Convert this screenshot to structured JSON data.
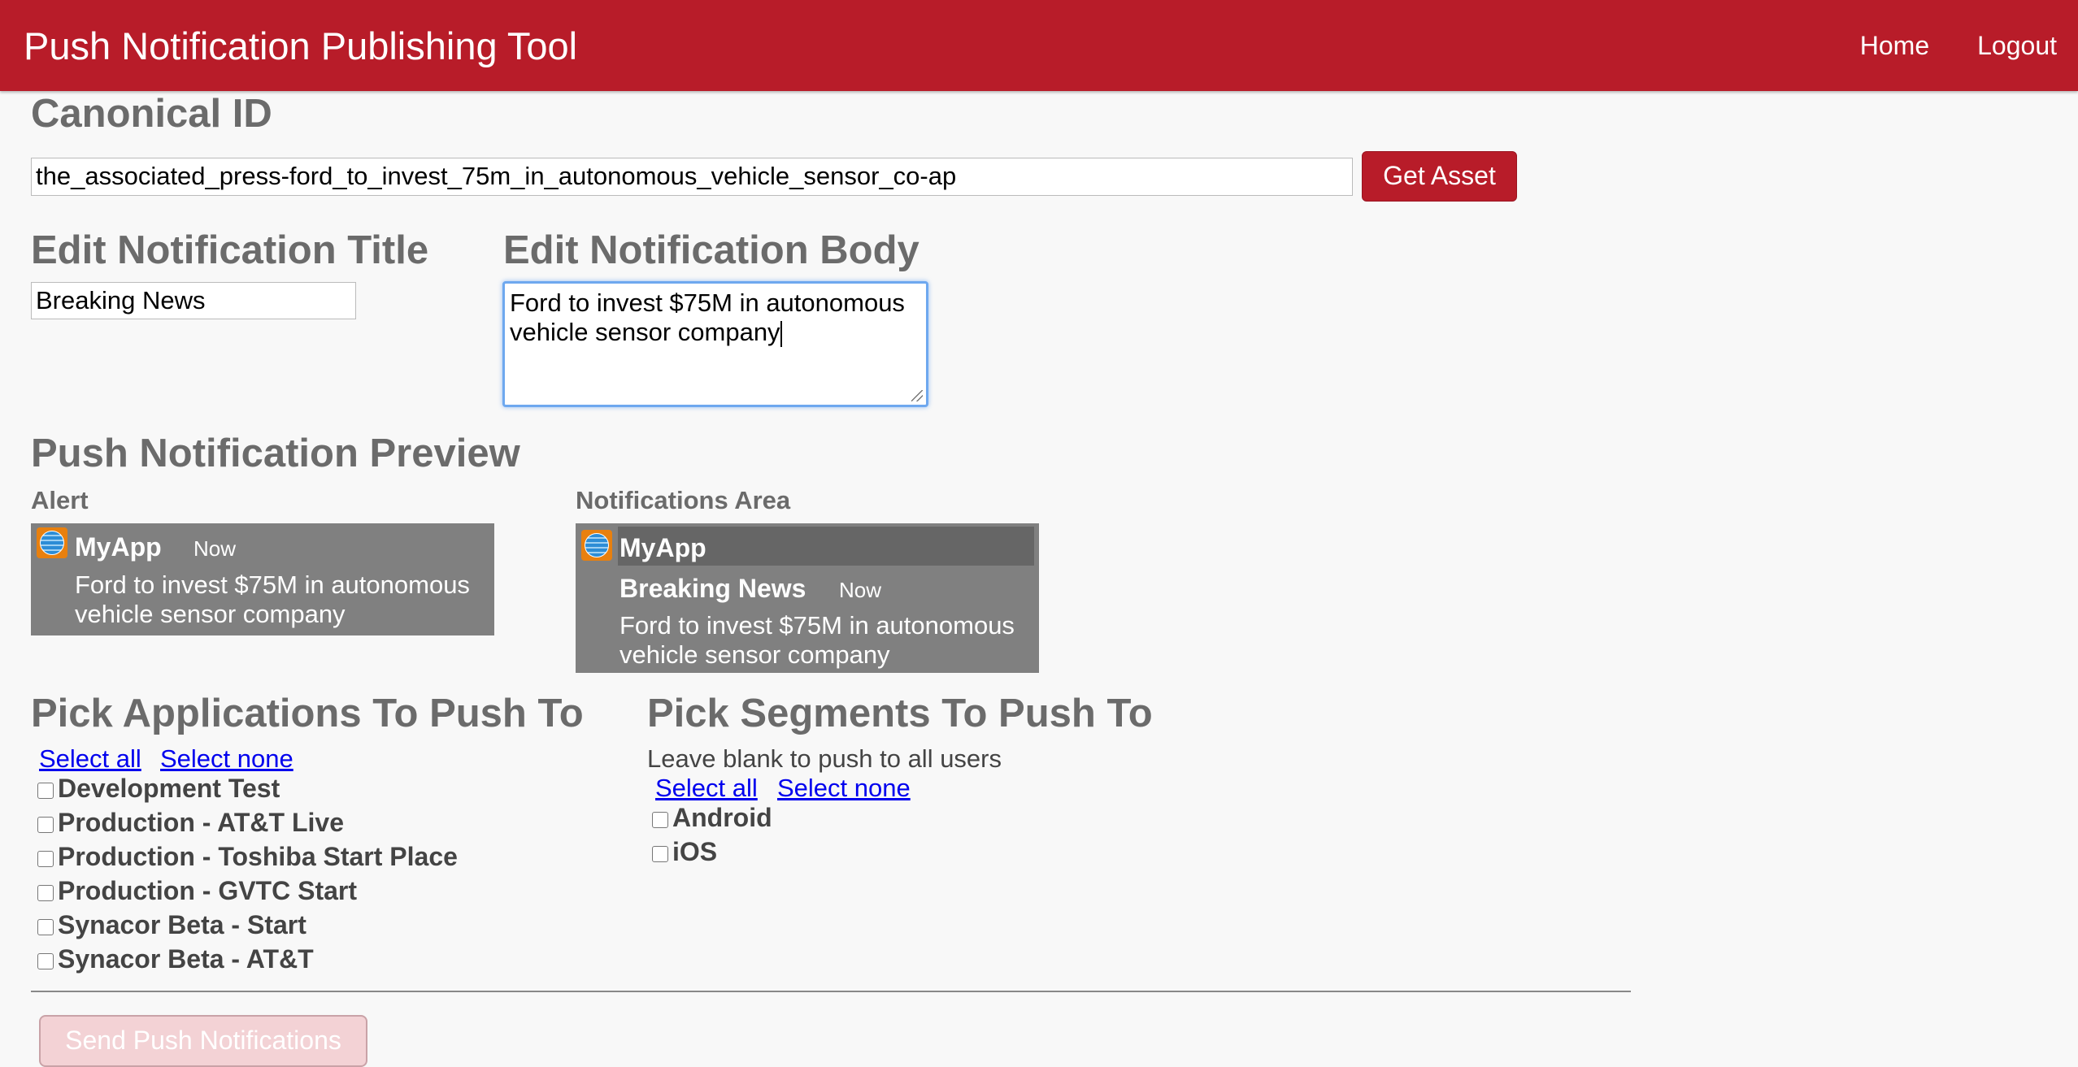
{
  "navbar": {
    "title": "Push Notification Publishing Tool",
    "links": [
      "Home",
      "Logout"
    ]
  },
  "canonical": {
    "heading": "Canonical ID",
    "value": "the_associated_press-ford_to_invest_75m_in_autonomous_vehicle_sensor_co-ap",
    "button": "Get Asset"
  },
  "edit_title": {
    "heading": "Edit Notification Title",
    "value": "Breaking News"
  },
  "edit_body": {
    "heading": "Edit Notification Body",
    "line1": "Ford to invest $75M in autonomous",
    "line2": "vehicle sensor company"
  },
  "preview": {
    "heading": "Push Notification Preview",
    "alert": {
      "label": "Alert",
      "app": "MyApp",
      "time": "Now",
      "line1": "Ford to invest $75M in autonomous",
      "line2": "vehicle sensor company"
    },
    "notifications": {
      "label": "Notifications Area",
      "app": "MyApp",
      "title": "Breaking News",
      "time": "Now",
      "line1": "Ford to invest $75M in autonomous",
      "line2": "vehicle sensor company"
    }
  },
  "applications": {
    "heading": "Pick Applications To Push To",
    "select_all": "Select all",
    "select_none": "Select none",
    "items": [
      "Development Test",
      "Production - AT&T Live",
      "Production - Toshiba Start Place",
      "Production - GVTC Start",
      "Synacor Beta - Start",
      "Synacor Beta - AT&T"
    ]
  },
  "segments": {
    "heading": "Pick Segments To Push To",
    "hint": "Leave blank to push to all users",
    "select_all": "Select all",
    "select_none": "Select none",
    "items": [
      "Android",
      "iOS"
    ]
  },
  "send_button": "Send Push Notifications",
  "colors": {
    "brand": "#b81c29",
    "preview_bg": "#808080",
    "preview_header": "#666666",
    "focus": "#6ea8ef"
  }
}
